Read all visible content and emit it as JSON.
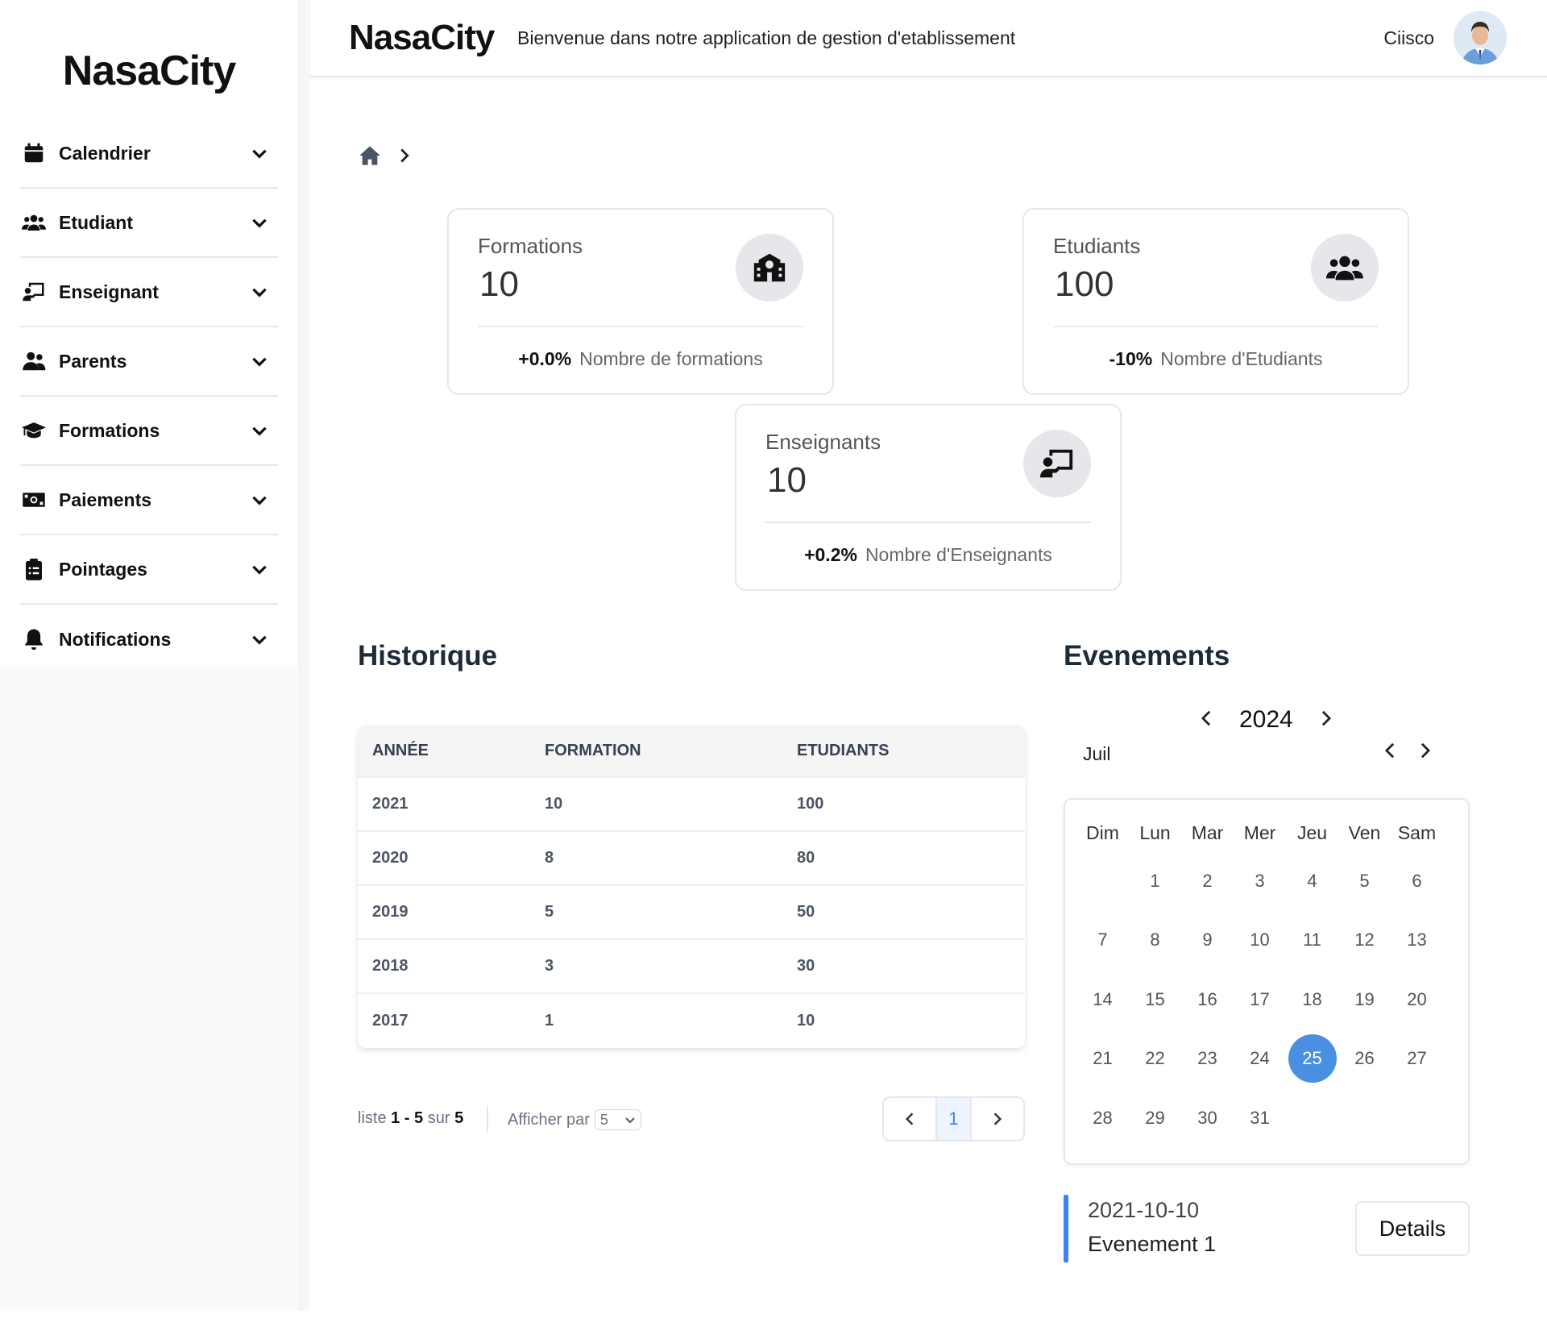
{
  "sidebar": {
    "logo": "NasaCity",
    "items": [
      {
        "label": "Calendrier",
        "icon": "calendar-icon"
      },
      {
        "label": "Etudiant",
        "icon": "users-icon"
      },
      {
        "label": "Enseignant",
        "icon": "chalkboard-teacher-icon"
      },
      {
        "label": "Parents",
        "icon": "user-group-icon"
      },
      {
        "label": "Formations",
        "icon": "graduation-cap-icon"
      },
      {
        "label": "Paiements",
        "icon": "money-bill-icon"
      },
      {
        "label": "Pointages",
        "icon": "clipboard-list-icon"
      },
      {
        "label": "Notifications",
        "icon": "bell-icon"
      }
    ]
  },
  "header": {
    "brand": "NasaCity",
    "welcome": "Bienvenue dans notre application de gestion d'etablissement",
    "user_name": "Ciisco"
  },
  "cards": {
    "formations": {
      "title": "Formations",
      "value": "10",
      "delta": "+0.0%",
      "caption": "Nombre de formations",
      "icon": "school-icon"
    },
    "etudiants": {
      "title": "Etudiants",
      "value": "100",
      "delta": "-10%",
      "caption": "Nombre d'Etudiants",
      "icon": "users-icon"
    },
    "enseignants": {
      "title": "Enseignants",
      "value": "10",
      "delta": "+0.2%",
      "caption": "Nombre d'Enseignants",
      "icon": "chalkboard-teacher-icon"
    }
  },
  "historique": {
    "title": "Historique",
    "columns": [
      "ANNÉE",
      "FORMATION",
      "ETUDIANTS"
    ],
    "rows": [
      [
        "2021",
        "10",
        "100"
      ],
      [
        "2020",
        "8",
        "80"
      ],
      [
        "2019",
        "5",
        "50"
      ],
      [
        "2018",
        "3",
        "30"
      ],
      [
        "2017",
        "1",
        "10"
      ]
    ],
    "pagination": {
      "prefix": "liste",
      "range": "1 - 5",
      "of": "sur",
      "total": "5",
      "per_page_label": "Afficher par",
      "per_page_value": "5",
      "current_page": "1"
    }
  },
  "evenements": {
    "title": "Evenements",
    "year": "2024",
    "month": "Juil",
    "weekdays": [
      "Dim",
      "Lun",
      "Mar",
      "Mer",
      "Jeu",
      "Ven",
      "Sam"
    ],
    "first_weekday_offset": 1,
    "days_in_month": 31,
    "selected_day": 25,
    "event": {
      "date": "2021-10-10",
      "name": "Evenement 1",
      "button": "Details"
    }
  },
  "colors": {
    "accent": "#3b82f6",
    "selected_day": "#4a90e2"
  }
}
